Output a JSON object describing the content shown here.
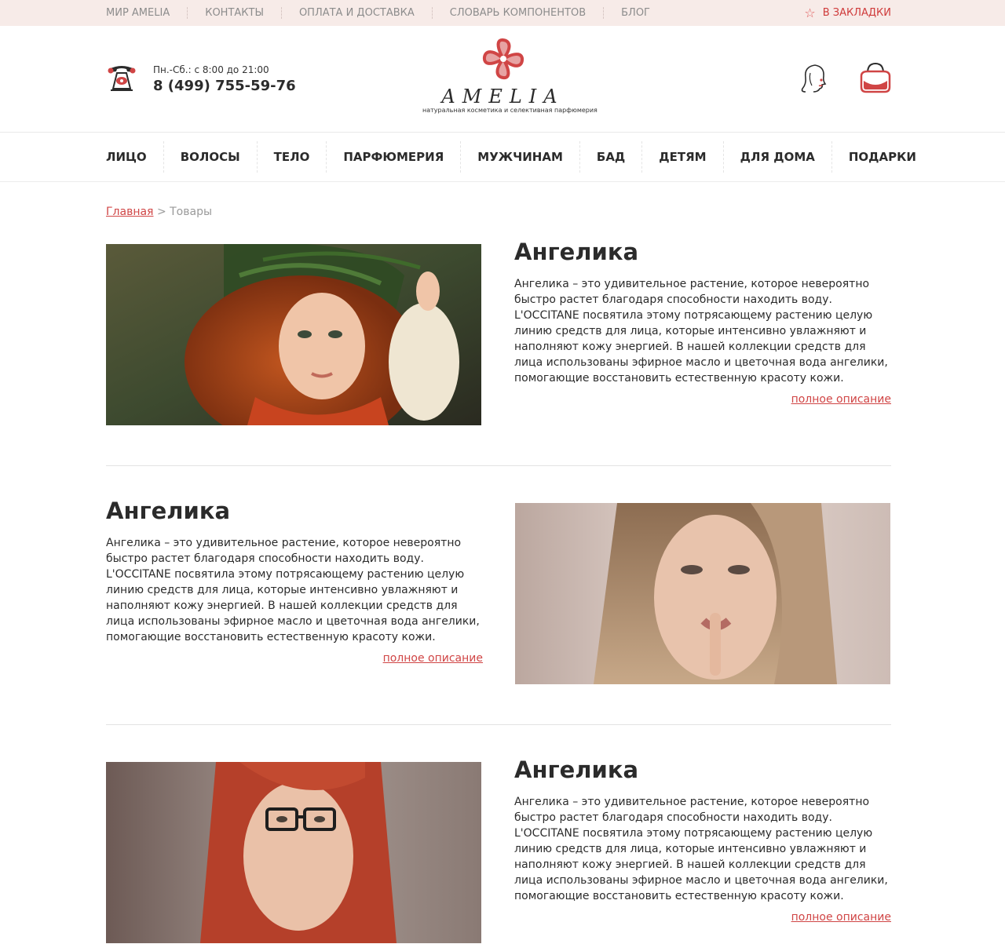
{
  "topbar": {
    "nav": [
      "МИР AMELIA",
      "КОНТАКТЫ",
      "ОПЛАТА И ДОСТАВКА",
      "СЛОВАРЬ КОМПОНЕНТОВ",
      "БЛОГ"
    ],
    "bookmarks_label": "В ЗАКЛАДКИ",
    "bookmarks_icon": "star-outline-icon"
  },
  "header": {
    "hours": "Пн.-Сб.: с 8:00 до 21:00",
    "phone": "8 (499) 755-59-76",
    "phone_icon": "retro-telephone-icon",
    "logo": {
      "brand": "AMELIA",
      "tagline": "натуральная косметика и селективная парфюмерия"
    },
    "user_icon": "woman-profile-icon",
    "bag_icon": "handbag-icon",
    "accent_color": "#d04545"
  },
  "mainnav": [
    "ЛИЦО",
    "ВОЛОСЫ",
    "ТЕЛО",
    "ПАРФЮМЕРИЯ",
    "МУЖЧИНАМ",
    "БАД",
    "ДЕТЯМ",
    "ДЛЯ ДОМА",
    "ПОДАРКИ"
  ],
  "breadcrumb": {
    "home": "Главная",
    "separator": ">",
    "current": "Товары"
  },
  "products": [
    {
      "title": "Ангелика",
      "description": "Ангелика – это удивительное растение, которое невероятно быстро растет благодаря способности находить воду. L'OCCITANE посвятила этому потрясающему растению целую линию средств для лица, которые интенсивно увлажняют и наполняют кожу энергией. В нашей коллекции средств для лица использованы эфирное масло и цветочная вода ангелики, помогающие восстановить естественную красоту кожи.",
      "more": "полное описание"
    },
    {
      "title": "Ангелика",
      "description": "Ангелика – это удивительное растение, которое невероятно быстро растет благодаря способности находить воду. L'OCCITANE посвятила этому потрясающему растению целую линию средств для лица, которые интенсивно увлажняют и наполняют кожу энергией. В нашей коллекции средств для лица использованы эфирное масло и цветочная вода ангелики, помогающие восстановить естественную красоту кожи.",
      "more": "полное описание"
    },
    {
      "title": "Ангелика",
      "description": "Ангелика – это удивительное растение, которое невероятно быстро растет благодаря способности находить воду. L'OCCITANE посвятила этому потрясающему растению целую линию средств для лица, которые интенсивно увлажняют и наполняют кожу энергией. В нашей коллекции средств для лица использованы эфирное масло и цветочная вода ангелики, помогающие восстановить естественную красоту кожи.",
      "more": "полное описание"
    }
  ]
}
